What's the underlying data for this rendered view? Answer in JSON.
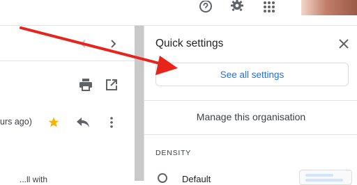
{
  "topbar": {
    "help_icon": "help-circle-icon",
    "settings_icon": "gear-icon",
    "apps_icon": "apps-grid-icon"
  },
  "mail_view": {
    "nav_prev_icon": "chevron-left-icon",
    "nav_next_icon": "chevron-right-icon",
    "print_icon": "print-icon",
    "open_new_window_icon": "open-in-new-icon",
    "sender_time": "urs ago)",
    "star_icon": "star-icon",
    "reply_icon": "reply-icon",
    "more_icon": "more-vert-icon",
    "snippet": "...ll with"
  },
  "quick_settings": {
    "title": "Quick settings",
    "close_icon": "close-icon",
    "see_all": "See all settings",
    "manage_org": "Manage this organisation",
    "density_heading": "DENSITY",
    "density_option_default": "Default"
  },
  "annotation": {
    "arrow_color": "#e8231a"
  },
  "colors": {
    "accent": "#1a73e8",
    "star": "#f4b400",
    "divider": "#e3e3e3"
  }
}
